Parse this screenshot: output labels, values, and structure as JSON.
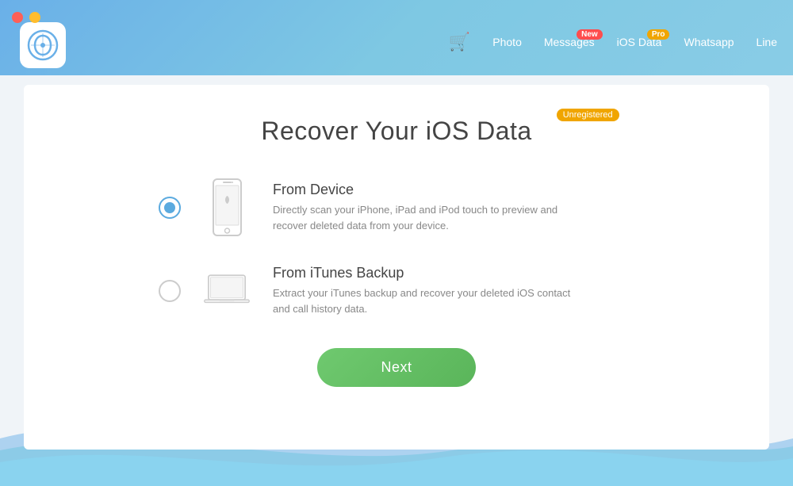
{
  "titlebar": {
    "controls": {
      "close_label": "×",
      "minimize_label": "−"
    },
    "logo_alt": "Copytrans app logo"
  },
  "nav": {
    "cart_icon": "🛒",
    "items": [
      {
        "id": "photo",
        "label": "Photo",
        "badge": null
      },
      {
        "id": "messages",
        "label": "Messages",
        "badge": "New",
        "badge_type": "new"
      },
      {
        "id": "ios-data",
        "label": "iOS Data",
        "badge": "Pro",
        "badge_type": "pro"
      },
      {
        "id": "whatsapp",
        "label": "Whatsapp",
        "badge": null
      },
      {
        "id": "line",
        "label": "Line",
        "badge": null
      }
    ]
  },
  "main": {
    "title": "Recover Your iOS Data",
    "unreg_badge": "Unregistered",
    "options": [
      {
        "id": "from-device",
        "label": "From Device",
        "description": "Directly scan your iPhone, iPad and iPod touch to preview and recover deleted data from your device.",
        "selected": true,
        "icon": "iphone"
      },
      {
        "id": "from-itunes",
        "label": "From iTunes Backup",
        "description": "Extract your iTunes backup and recover your deleted iOS contact and call history data.",
        "selected": false,
        "icon": "laptop"
      }
    ],
    "next_button": "Next"
  }
}
